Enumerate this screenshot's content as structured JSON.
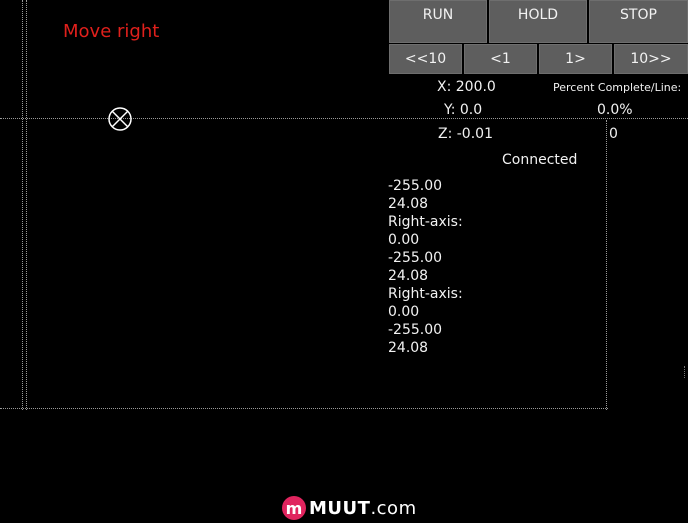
{
  "status": {
    "message": "Move right",
    "connection": "Connected"
  },
  "controls": {
    "run_label": "RUN",
    "hold_label": "HOLD",
    "stop_label": "STOP",
    "jog_back_10_label": "<<10",
    "jog_back_1_label": "<1",
    "jog_fwd_1_label": "1>",
    "jog_fwd_10_label": "10>>"
  },
  "position": {
    "x_label": "X: 200.0",
    "y_label": "Y: 0.0",
    "z_label": "Z: -0.01"
  },
  "progress": {
    "title": "Percent Complete/Line:",
    "percent": "0.0%",
    "line": "0"
  },
  "log": [
    "-255.00",
    "24.08",
    "Right-axis:",
    "0.00",
    "-255.00",
    "24.08",
    "Right-axis:",
    "0.00",
    "-255.00",
    "24.08"
  ],
  "watermark": {
    "letter": "m",
    "brand": "MUUT",
    "domain": ".com"
  },
  "colors": {
    "background": "#000000",
    "button": "#5e5e5e",
    "status_message": "#e0201c",
    "brand": "#e0245e"
  },
  "icons": {
    "tool_position": "crosshair-icon"
  }
}
